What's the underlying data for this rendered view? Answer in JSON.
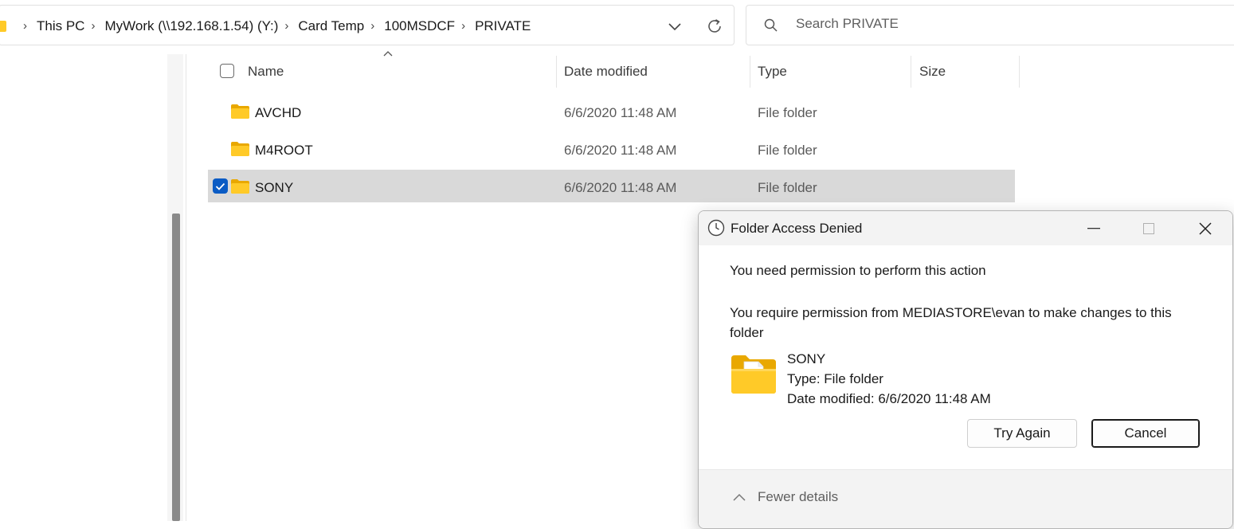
{
  "address_bar": {
    "breadcrumbs": [
      "This PC",
      "MyWork (\\\\192.168.1.54) (Y:)",
      "Card Temp",
      "100MSDCF",
      "PRIVATE"
    ]
  },
  "search": {
    "placeholder": "Search PRIVATE"
  },
  "columns": {
    "name": "Name",
    "date": "Date modified",
    "type": "Type",
    "size": "Size"
  },
  "files": [
    {
      "name": "AVCHD",
      "date": "6/6/2020 11:48 AM",
      "type": "File folder",
      "selected": false
    },
    {
      "name": "M4ROOT",
      "date": "6/6/2020 11:48 AM",
      "type": "File folder",
      "selected": false
    },
    {
      "name": "SONY",
      "date": "6/6/2020 11:48 AM",
      "type": "File folder",
      "selected": true
    }
  ],
  "dialog": {
    "title": "Folder Access Denied",
    "message": "You need permission to perform this action",
    "detail": "You require permission from MEDIASTORE\\evan to make changes to this folder",
    "item_name": "SONY",
    "item_type": "Type: File folder",
    "item_date": "Date modified: 6/6/2020 11:48 AM",
    "try_again": "Try Again",
    "cancel": "Cancel",
    "fewer_details": "Fewer details"
  },
  "colors": {
    "folder": "#ffca28",
    "selection": "#d9d9d9",
    "checkbox": "#0a5bc4"
  }
}
